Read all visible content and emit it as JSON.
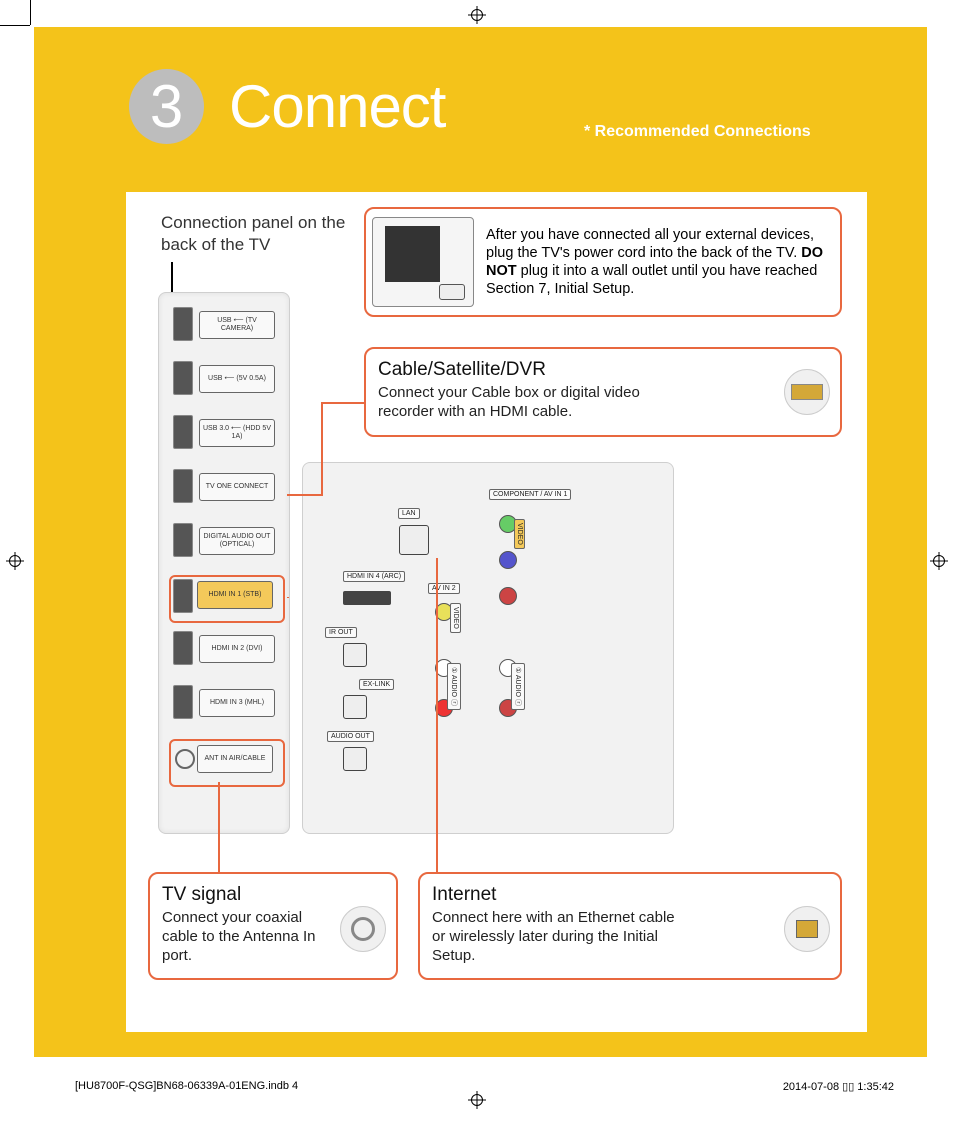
{
  "step": {
    "number": "3",
    "title": "Connect",
    "subtitle": "* Recommended Connections"
  },
  "panel_caption": "Connection panel on the back of the TV",
  "ports_v": [
    {
      "label": "USB ⟵\n(TV CAMERA)"
    },
    {
      "label": "USB ⟵\n(5V 0.5A)"
    },
    {
      "label": "USB 3.0 ⟵\n(HDD 5V 1A)"
    },
    {
      "label": "TV\nONE\nCONNECT"
    },
    {
      "label": "DIGITAL\nAUDIO OUT\n(OPTICAL)"
    },
    {
      "label": "HDMI IN 1\n(STB)",
      "highlight": true
    },
    {
      "label": "HDMI IN 2\n(DVI)"
    },
    {
      "label": "HDMI IN 3\n(MHL)"
    },
    {
      "label": "ANT IN\nAIR/CABLE",
      "coax": true,
      "highlight": true
    }
  ],
  "panel2": {
    "lan": "LAN",
    "hdmi4": "HDMI IN 4\n(ARC)",
    "irout": "IR OUT",
    "exlink": "EX-LINK",
    "audioout": "AUDIO OUT",
    "avin2": "AV IN 2",
    "component": "COMPONENT\n/ AV IN 1",
    "video": "VIDEO",
    "audioL": "① AUDIO ⓡ",
    "audioR": "① AUDIO ⓡ"
  },
  "topnote": {
    "text_pre": "After you have connected all your external devices, plug the TV's power cord into the back of the TV. ",
    "bold": "DO NOT",
    "text_post": " plug it into a wall outlet until you have reached Section 7, Initial Setup."
  },
  "c_cable": {
    "title": "Cable/Satellite/DVR",
    "body": "Connect your Cable box or digital video recorder with an HDMI cable."
  },
  "c_tv": {
    "title": "TV signal",
    "body": "Connect your coaxial cable to the Antenna In port."
  },
  "c_net": {
    "title": "Internet",
    "body": "Connect here with an Ethernet cable or wirelessly later during the Initial Setup."
  },
  "footer": {
    "left": "[HU8700F-QSG]BN68-06339A-01ENG.indb   4",
    "right": "2014-07-08   ▯▯ 1:35:42"
  }
}
